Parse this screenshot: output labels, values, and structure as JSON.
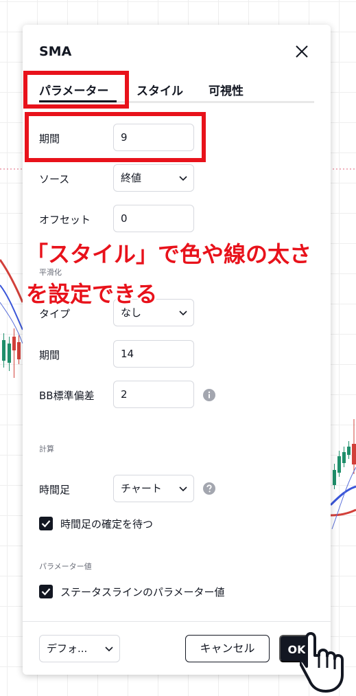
{
  "dialog": {
    "title": "SMA",
    "close_icon": "close-icon"
  },
  "tabs": [
    {
      "label": "パラメーター",
      "active": true
    },
    {
      "label": "スタイル",
      "active": false
    },
    {
      "label": "可視性",
      "active": false
    }
  ],
  "inputs": {
    "period": {
      "label": "期間",
      "value": "9"
    },
    "source": {
      "label": "ソース",
      "value": "終値"
    },
    "offset": {
      "label": "オフセット",
      "value": "0"
    }
  },
  "smoothing": {
    "section_label": "平滑化",
    "type": {
      "label": "タイプ",
      "value": "なし"
    },
    "period": {
      "label": "期間",
      "value": "14"
    },
    "bb_std": {
      "label": "BB標準偏差",
      "value": "2"
    }
  },
  "calculation": {
    "section_label": "計算",
    "timeframe": {
      "label": "時間足",
      "value": "チャート"
    },
    "wait_close": {
      "label": "時間足の確定を待つ",
      "checked": true
    }
  },
  "param_values": {
    "section_label": "パラメーター値",
    "status_line": {
      "label": "ステータスラインのパラメーター値",
      "checked": true
    }
  },
  "footer": {
    "defaults": "デフォ...",
    "cancel": "キャンセル",
    "ok": "OK"
  },
  "annotation": {
    "line1": "「スタイル」で色や線の太さ",
    "line2": "を設定できる",
    "color": "#e8121b"
  },
  "colors": {
    "text": "#131722",
    "highlight": "#e8121b",
    "sma_red": "#d2403a",
    "sma_blue": "#3a56d9",
    "candle_green": "#1f8f6b",
    "candle_red": "#d2403a"
  }
}
